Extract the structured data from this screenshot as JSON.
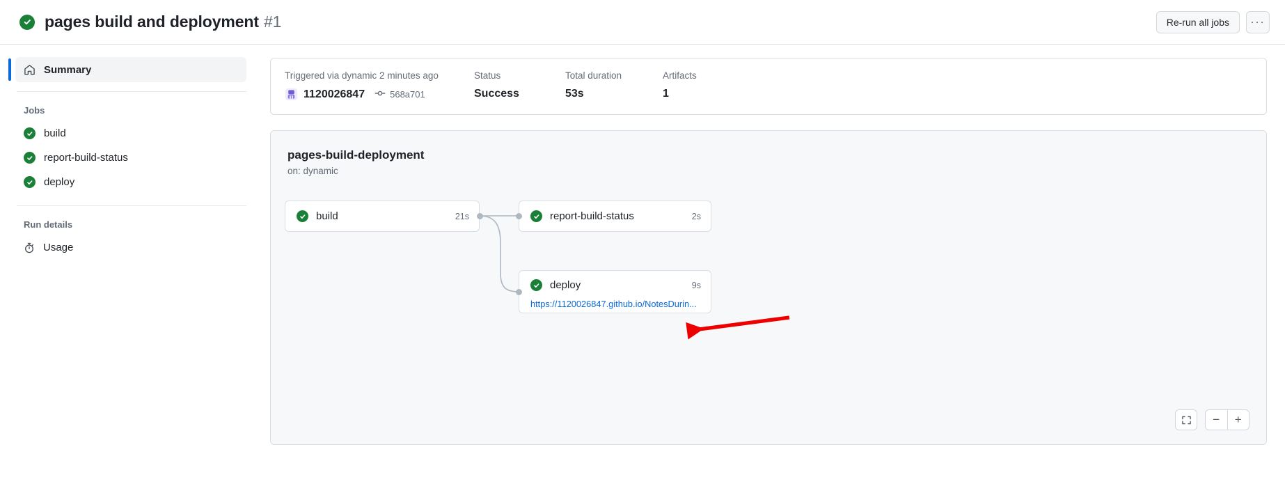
{
  "header": {
    "status_icon": "check-circle-icon",
    "title": "pages build and deployment",
    "run_number": "#1",
    "rerun_label": "Re-run all jobs",
    "more_label": "···"
  },
  "sidebar": {
    "summary": {
      "label": "Summary",
      "icon": "home-icon"
    },
    "jobs_heading": "Jobs",
    "jobs": [
      {
        "label": "build",
        "icon": "check-circle-icon"
      },
      {
        "label": "report-build-status",
        "icon": "check-circle-icon"
      },
      {
        "label": "deploy",
        "icon": "check-circle-icon"
      }
    ],
    "run_details_heading": "Run details",
    "usage": {
      "label": "Usage",
      "icon": "stopwatch-icon"
    }
  },
  "info": {
    "trigger_label": "Triggered via dynamic 2 minutes ago",
    "actor": "1120026847",
    "commit_sha": "568a701",
    "status_label": "Status",
    "status_value": "Success",
    "duration_label": "Total duration",
    "duration_value": "53s",
    "artifacts_label": "Artifacts",
    "artifacts_value": "1"
  },
  "graph": {
    "title": "pages-build-deployment",
    "subtitle": "on: dynamic",
    "nodes": [
      {
        "label": "build",
        "duration": "21s",
        "icon": "check-circle-icon",
        "link": ""
      },
      {
        "label": "report-build-status",
        "duration": "2s",
        "icon": "check-circle-icon",
        "link": ""
      },
      {
        "label": "deploy",
        "duration": "9s",
        "icon": "check-circle-icon",
        "link": "https://1120026847.github.io/NotesDurin..."
      }
    ],
    "controls": {
      "fit_icon": "fullscreen-icon",
      "zoom_out": "−",
      "zoom_in": "+"
    }
  },
  "colors": {
    "success_green": "#1a7f37",
    "link_blue": "#0969da",
    "annotation_red": "#ee0000",
    "panel_bg": "#f6f8fa",
    "border": "#d8dee4"
  }
}
